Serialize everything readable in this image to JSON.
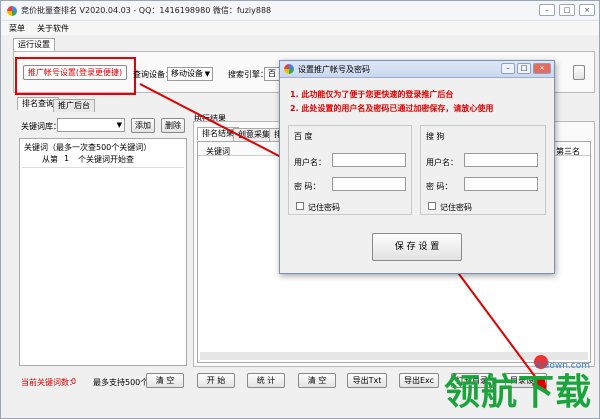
{
  "window": {
    "title": "竞价批量查排名 V2020.04.03 - QQ：1416198980 微信：fuziy888",
    "controls": [
      "–",
      "□",
      "×"
    ]
  },
  "menu": [
    "菜单",
    "关于软件"
  ],
  "run_settings_tab": "运行设置",
  "toolbar": {
    "promo_account_button": "推广帐号设置(登录更便捷)",
    "query_device_label": "查询设备：",
    "device_value": "移动设备",
    "search_engine_label": "搜索引擎：",
    "search_engine_value": "百"
  },
  "left_tabs": [
    "排名查询",
    "推广后台"
  ],
  "keyword_library_label": "关键词库：",
  "add_button": "添加",
  "delete_button": "删除",
  "keywords_box": {
    "title": "关键词（最多一次查500个关键词）",
    "start_prefix": "从第",
    "start_value": "1",
    "start_suffix": "个关键词开始查"
  },
  "current_keywords_label": "当前关键词数：",
  "current_keywords_value": "0",
  "max_support": "最多支持500个",
  "clear_left_button": "清 空",
  "results": {
    "group_title": "执行结果",
    "tabs": [
      "排名结果",
      "创意采集",
      "排"
    ],
    "column_keyword": "关键词",
    "column_third": "第三名"
  },
  "bottom_buttons": [
    "开 始",
    "统 计",
    "清 空",
    "导出Txt",
    "导出Exc",
    "打开目录",
    "目录设置"
  ],
  "dialog": {
    "title": "设置推广帐号及密码",
    "note1": "1. 此功能仅为了便于您更快速的登录推广后台",
    "note2": "2. 此处设置的用户名及密码已通过加密保存，请放心使用",
    "baidu": {
      "title": "百 度",
      "username_label": "用户名：",
      "password_label": "密  码：",
      "remember_label": "记住密码"
    },
    "sogou": {
      "title": "搜 狗",
      "username_label": "用户名：",
      "password_label": "密  码：",
      "remember_label": "记住密码"
    },
    "save_button": "保 存 设 置"
  },
  "watermark": {
    "text": "领航下载",
    "url": "lhdown.com"
  },
  "colors": {
    "red": "#e00000",
    "watermark_green": "#19a53b"
  }
}
